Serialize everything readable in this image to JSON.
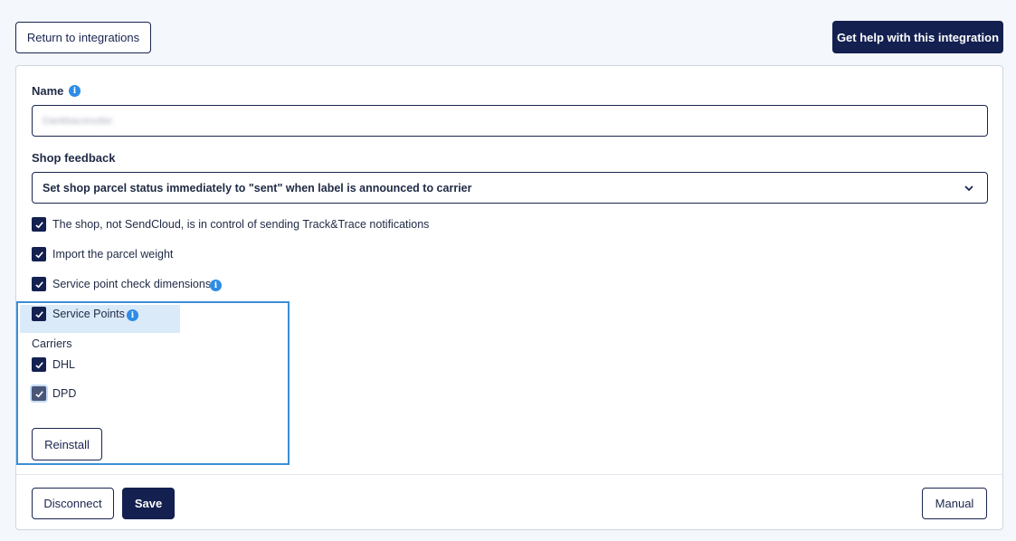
{
  "header": {
    "return_label": "Return to integrations",
    "help_label": "Get help with this integration"
  },
  "form": {
    "name_label": "Name",
    "name_value": "Dankbaconutter",
    "shop_feedback_label": "Shop feedback",
    "shop_feedback_value": "Set shop parcel status immediately to \"sent\" when label is announced to carrier",
    "checkboxes": [
      {
        "label": "The shop, not SendCloud, is in control of sending Track&Trace notifications",
        "checked": true
      },
      {
        "label": "Import the parcel weight",
        "checked": true
      },
      {
        "label": "Service point check dimensions",
        "checked": true
      },
      {
        "label": "Service Points",
        "checked": true
      }
    ],
    "carriers_label": "Carriers",
    "carriers": [
      {
        "label": "DHL",
        "checked": true
      },
      {
        "label": "DPD",
        "checked": true
      }
    ],
    "reinstall_label": "Reinstall"
  },
  "footer": {
    "disconnect_label": "Disconnect",
    "save_label": "Save",
    "manual_label": "Manual"
  },
  "colors": {
    "primary": "#132050",
    "info": "#2e8ce6",
    "highlight": "#3b8fd4",
    "background": "#f4f7fb"
  }
}
